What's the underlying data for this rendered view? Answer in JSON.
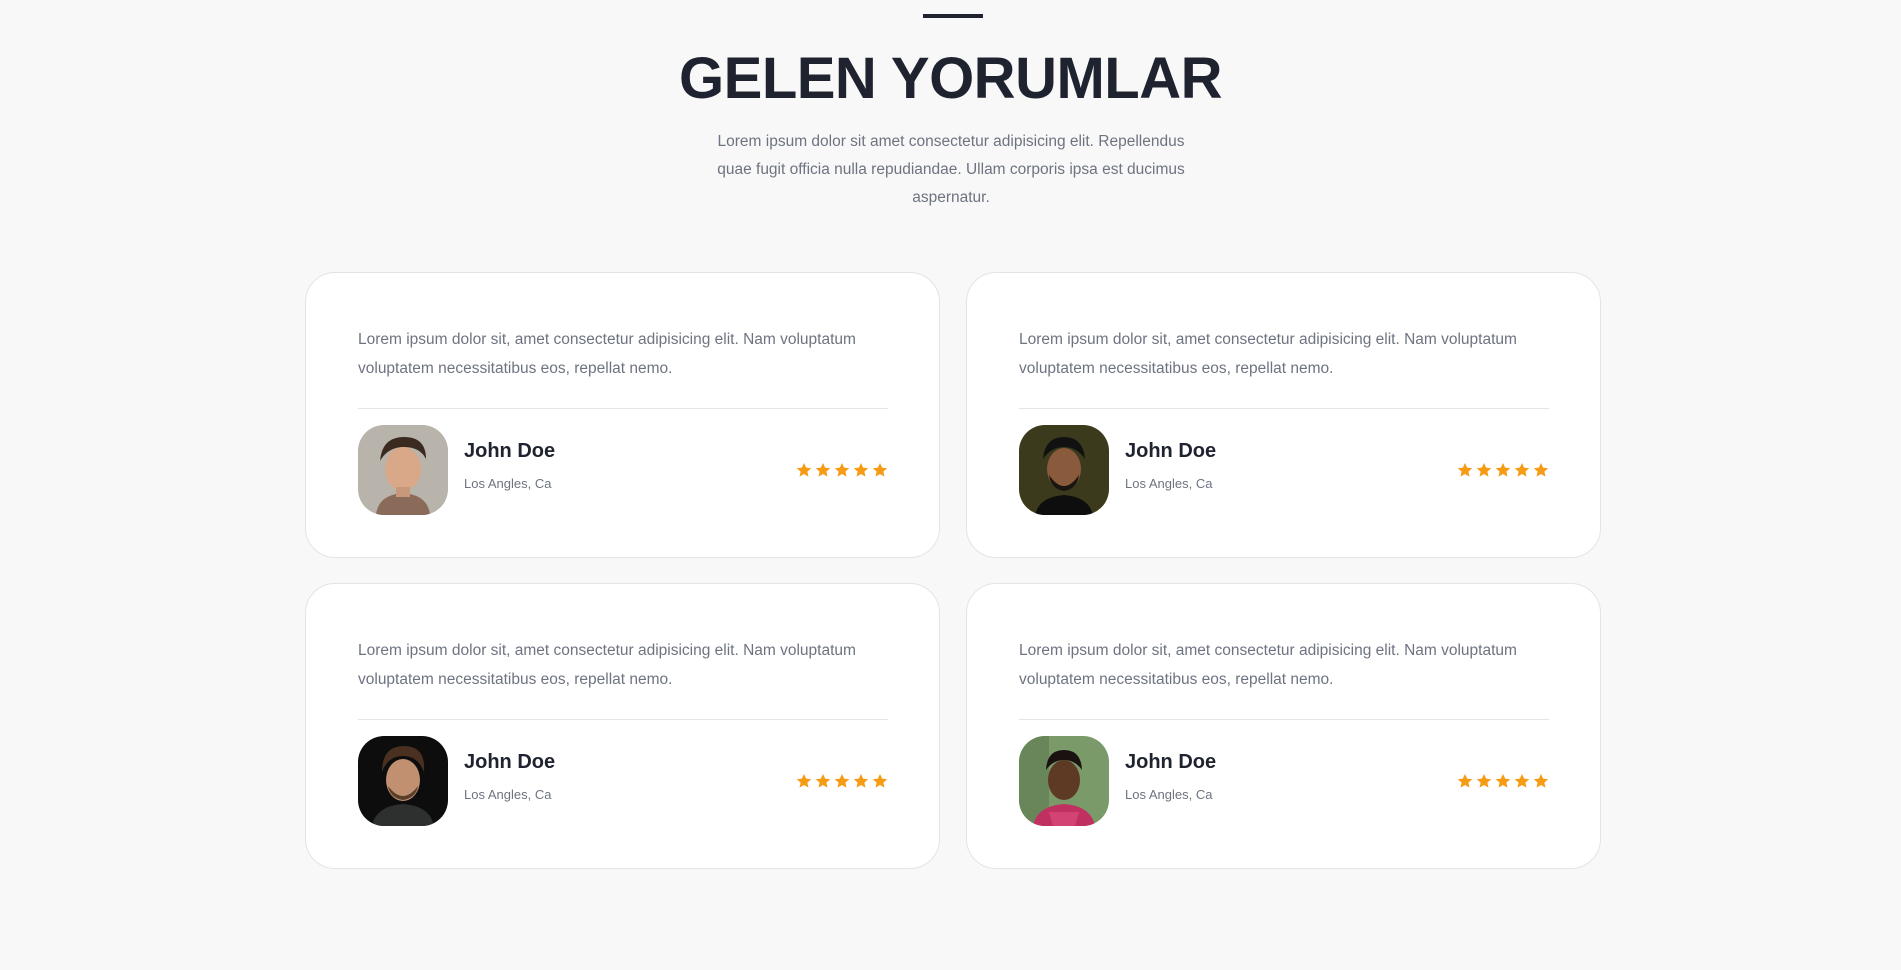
{
  "section": {
    "title": "GELEN YORUMLAR",
    "intro": "Lorem ipsum dolor sit amet consectetur adipisicing elit. Repellendus quae fugit officia nulla repudiandae. Ullam corporis ipsa est ducimus aspernatur."
  },
  "colors": {
    "accent_star": "#f59b14",
    "heading": "#1f2330",
    "body_text": "#6d7380",
    "background": "#f8f8f8"
  },
  "testimonials": [
    {
      "text": "Lorem ipsum dolor sit, amet consectetur adipisicing elit. Nam voluptatum voluptatem necessitatibus eos, repellat nemo.",
      "name": "John Doe",
      "location": "Los Angles, Ca",
      "rating": 5,
      "avatar_icon": "avatar-photo-1"
    },
    {
      "text": "Lorem ipsum dolor sit, amet consectetur adipisicing elit. Nam voluptatum voluptatem necessitatibus eos, repellat nemo.",
      "name": "John Doe",
      "location": "Los Angles, Ca",
      "rating": 5,
      "avatar_icon": "avatar-photo-2"
    },
    {
      "text": "Lorem ipsum dolor sit, amet consectetur adipisicing elit. Nam voluptatum voluptatem necessitatibus eos, repellat nemo.",
      "name": "John Doe",
      "location": "Los Angles, Ca",
      "rating": 5,
      "avatar_icon": "avatar-photo-3"
    },
    {
      "text": "Lorem ipsum dolor sit, amet consectetur adipisicing elit. Nam voluptatum voluptatem necessitatibus eos, repellat nemo.",
      "name": "John Doe",
      "location": "Los Angles, Ca",
      "rating": 5,
      "avatar_icon": "avatar-photo-4"
    }
  ]
}
